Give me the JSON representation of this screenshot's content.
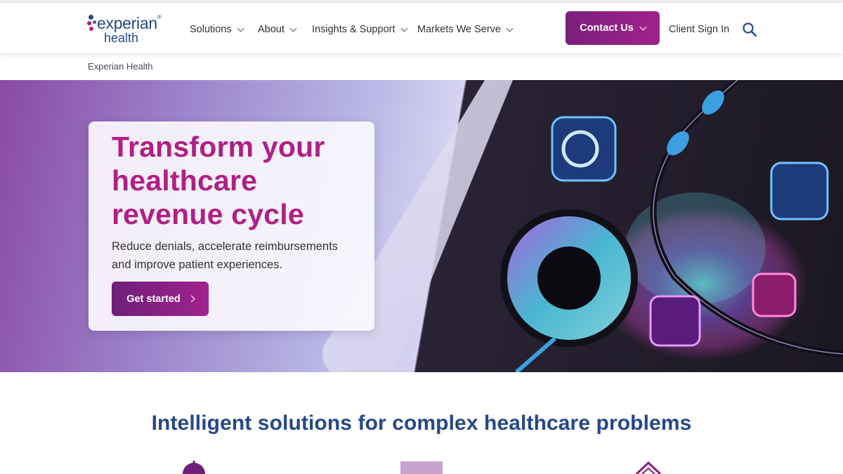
{
  "header": {
    "logo": {
      "line1": "experian",
      "line2": "health",
      "mark": "®"
    },
    "nav": [
      {
        "label": "Solutions"
      },
      {
        "label": "About"
      },
      {
        "label": "Insights & Support"
      },
      {
        "label": "Markets We Serve"
      }
    ],
    "contact_label": "Contact Us",
    "signin_label": "Client Sign In"
  },
  "breadcrumb": {
    "home": "Experian Health"
  },
  "hero": {
    "title": "Transform your healthcare revenue cycle",
    "subtitle": "Reduce denials, accelerate reimbursements and improve patient experiences.",
    "cta_label": "Get started"
  },
  "section": {
    "title": "Intelligent solutions for complex healthcare problems"
  },
  "icons": {
    "search": "search-icon",
    "dollar": "dollar-icon",
    "document": "document-icon",
    "house": "house-icon"
  },
  "colors": {
    "brand_blue": "#26478d",
    "brand_magenta": "#b01f87",
    "button_purple": "#7b1f7c"
  }
}
